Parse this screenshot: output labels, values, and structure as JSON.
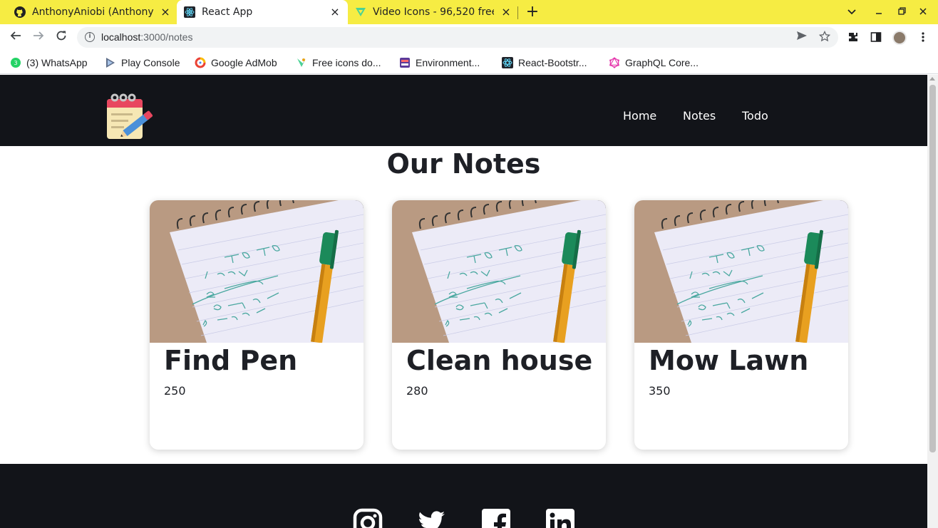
{
  "browser": {
    "tabs": [
      {
        "title": "AnthonyAniobi (Anthony A",
        "icon": "github-icon",
        "active": false
      },
      {
        "title": "React App",
        "icon": "react-icon",
        "active": true
      },
      {
        "title": "Video Icons - 96,520 free ic",
        "icon": "flaticon-icon",
        "active": false
      }
    ],
    "tab_close_glyph": "×",
    "new_tab_glyph": "+",
    "url_host": "localhost",
    "url_path": ":3000/notes",
    "bookmarks": [
      {
        "label": "(3) WhatsApp",
        "icon": "whatsapp-icon"
      },
      {
        "label": "Play Console",
        "icon": "play-console-icon"
      },
      {
        "label": "Google AdMob",
        "icon": "admob-icon"
      },
      {
        "label": "Free icons do...",
        "icon": "flaticon-icon"
      },
      {
        "label": "Environment...",
        "icon": "environment-icon"
      },
      {
        "label": "React-Bootstr...",
        "icon": "react-bootstrap-icon"
      },
      {
        "label": "GraphQL Core...",
        "icon": "graphql-icon"
      }
    ]
  },
  "site": {
    "nav": [
      {
        "label": "Home"
      },
      {
        "label": "Notes"
      },
      {
        "label": "Todo"
      }
    ],
    "page_title": "Our Notes",
    "notes": [
      {
        "title": "Find Pen",
        "value": "250"
      },
      {
        "title": "Clean house",
        "value": "280"
      },
      {
        "title": "Mow Lawn",
        "value": "350"
      }
    ],
    "social": [
      "instagram-icon",
      "twitter-icon",
      "facebook-icon",
      "linkedin-icon"
    ],
    "colors": {
      "header_bg": "#121419",
      "tab_strip": "#f6ec43",
      "text_dark": "#1e2026"
    }
  }
}
